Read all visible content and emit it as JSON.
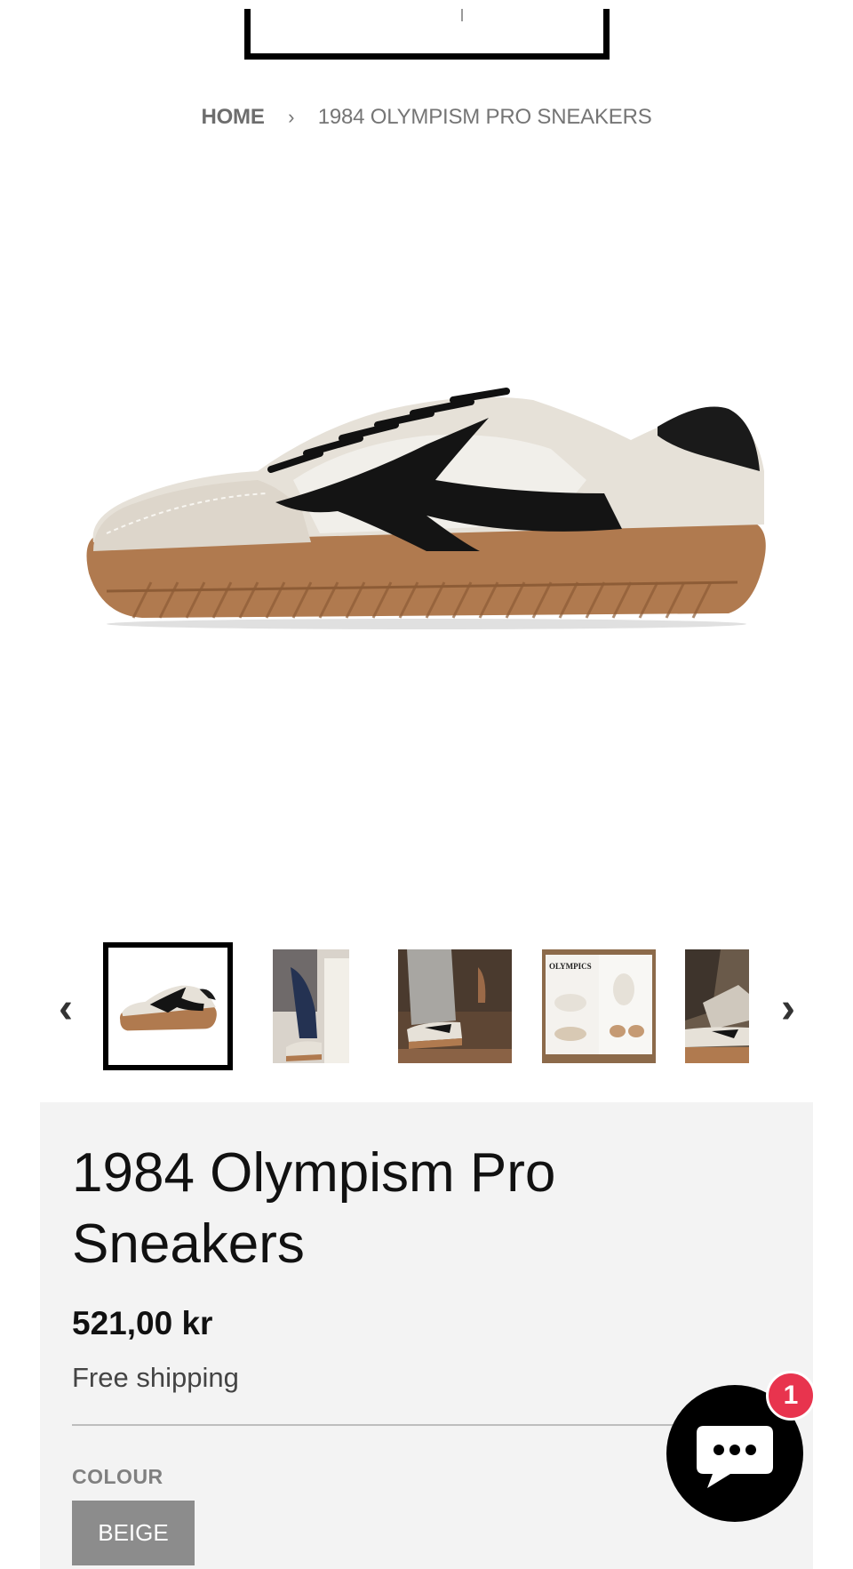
{
  "breadcrumb": {
    "home": "HOME",
    "separator": "›",
    "current": "1984 OLYMPISM PRO SNEAKERS"
  },
  "gallery": {
    "prev_icon": "chevron-left-icon",
    "next_icon": "chevron-right-icon",
    "prev_glyph": "‹",
    "next_glyph": "›",
    "thumbnail_count_visible": 5,
    "active_index": 0
  },
  "product": {
    "title": "1984 Olympism Pro Sneakers",
    "price": "521,00 kr",
    "shipping": "Free shipping",
    "colour_label": "COLOUR",
    "colour_value": "BEIGE"
  },
  "thumb_texts": {
    "magazine": "OLYMPICS"
  },
  "chat": {
    "icon": "chat-bubble-icon",
    "badge_count": "1"
  },
  "colors": {
    "panel_bg": "#f3f3f3",
    "badge": "#e8344e",
    "colour_button": "#8c8c8c",
    "sole": "#b07a4f"
  }
}
